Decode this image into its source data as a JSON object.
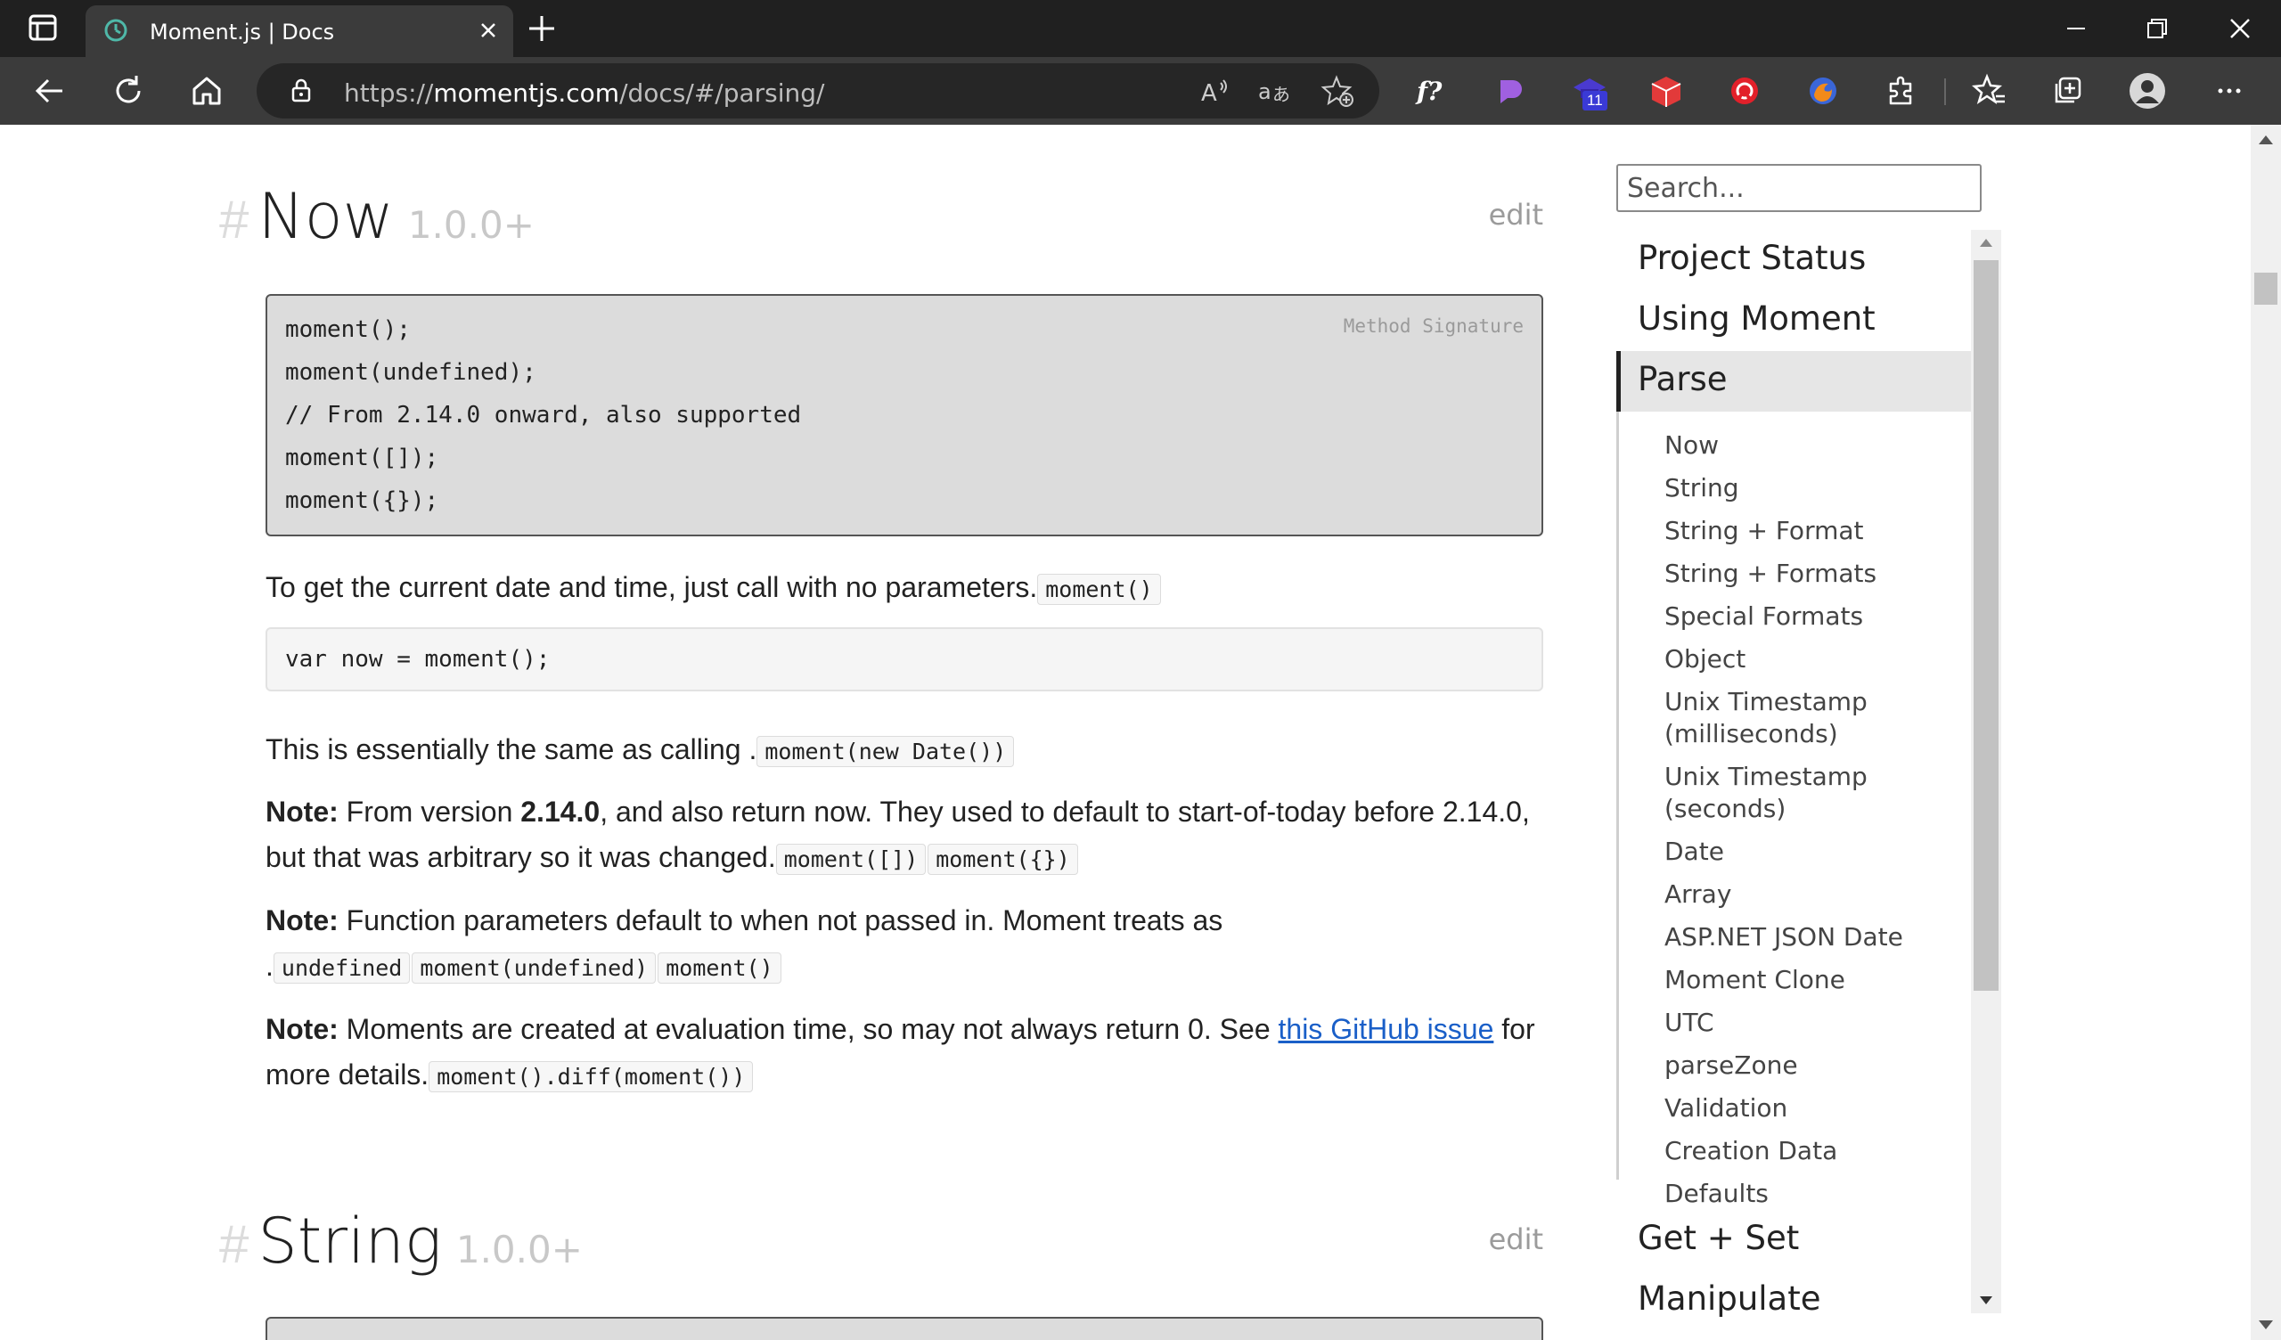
{
  "browser": {
    "tab_title": "Moment.js | Docs",
    "url_prefix": "https://",
    "url_host": "momentjs.com",
    "url_path": "/docs/#/parsing/",
    "extension_badge": "11",
    "icons": [
      "tab-actions-icon",
      "moment-favicon-icon",
      "close-tab-icon",
      "new-tab-icon",
      "minimize-icon",
      "restore-icon",
      "close-window-icon",
      "back-icon",
      "refresh-icon",
      "home-icon",
      "lock-icon",
      "read-aloud-icon",
      "translate-icon",
      "add-favorite-icon",
      "math-solver-icon",
      "extension-purple-icon",
      "extension-hat-icon",
      "extension-cube-icon",
      "extension-red-icon",
      "extension-firefox-icon",
      "extensions-icon",
      "favorites-icon",
      "collections-icon",
      "profile-avatar",
      "more-menu-icon"
    ]
  },
  "colors": {
    "chrome_dark": "#202020",
    "chrome_toolbar": "#3b3b3b",
    "link": "#1a5fc8",
    "code_bg": "#dcdcdc"
  },
  "section_now": {
    "hash": "#",
    "title": "Now",
    "version": "1.0.0+",
    "edit": "edit",
    "signature_label": "Method Signature",
    "signature_lines": [
      "moment();",
      "moment(undefined);",
      "// From 2.14.0 onward, also supported",
      "moment([]);",
      "moment({});"
    ],
    "p1_text": "To get the current date and time, just call with no parameters.",
    "p1_code": "moment()",
    "example_code": "var now = moment();",
    "p2_text": "This is essentially the same as calling .",
    "p2_code": "moment(new Date())",
    "note_label": "Note:",
    "n1_a": "From version ",
    "n1_version": "2.14.0",
    "n1_b": ", and also return now. They used to default to start-of-today before 2.14.0, but that was arbitrary so it was changed.",
    "n1_code1": "moment([])",
    "n1_code2": "moment({})",
    "n2_a": "Function parameters default to when not passed in. Moment treats as",
    "n2_dot": ".",
    "n2_code1": "undefined",
    "n2_code2": "moment(undefined)",
    "n2_code3": "moment()",
    "n3_a": "Moments are created at evaluation time, so may not always return 0. See ",
    "n3_link": "this GitHub issue",
    "n3_b": " for more details.",
    "n3_code": "moment().diff(moment())"
  },
  "section_string": {
    "hash": "#",
    "title": "String",
    "version": "1.0.0+",
    "edit": "edit"
  },
  "sidebar": {
    "search_placeholder": "Search...",
    "top_items": [
      "Project Status",
      "Using Moment"
    ],
    "active_item": "Parse",
    "sub_items": [
      "Now",
      "String",
      "String + Format",
      "String + Formats",
      "Special Formats",
      "Object",
      "Unix Timestamp (milliseconds)",
      "Unix Timestamp (seconds)",
      "Date",
      "Array",
      "ASP.NET JSON Date",
      "Moment Clone",
      "UTC",
      "parseZone",
      "Validation",
      "Creation Data",
      "Defaults"
    ],
    "bottom_items": [
      "Get + Set",
      "Manipulate"
    ]
  }
}
